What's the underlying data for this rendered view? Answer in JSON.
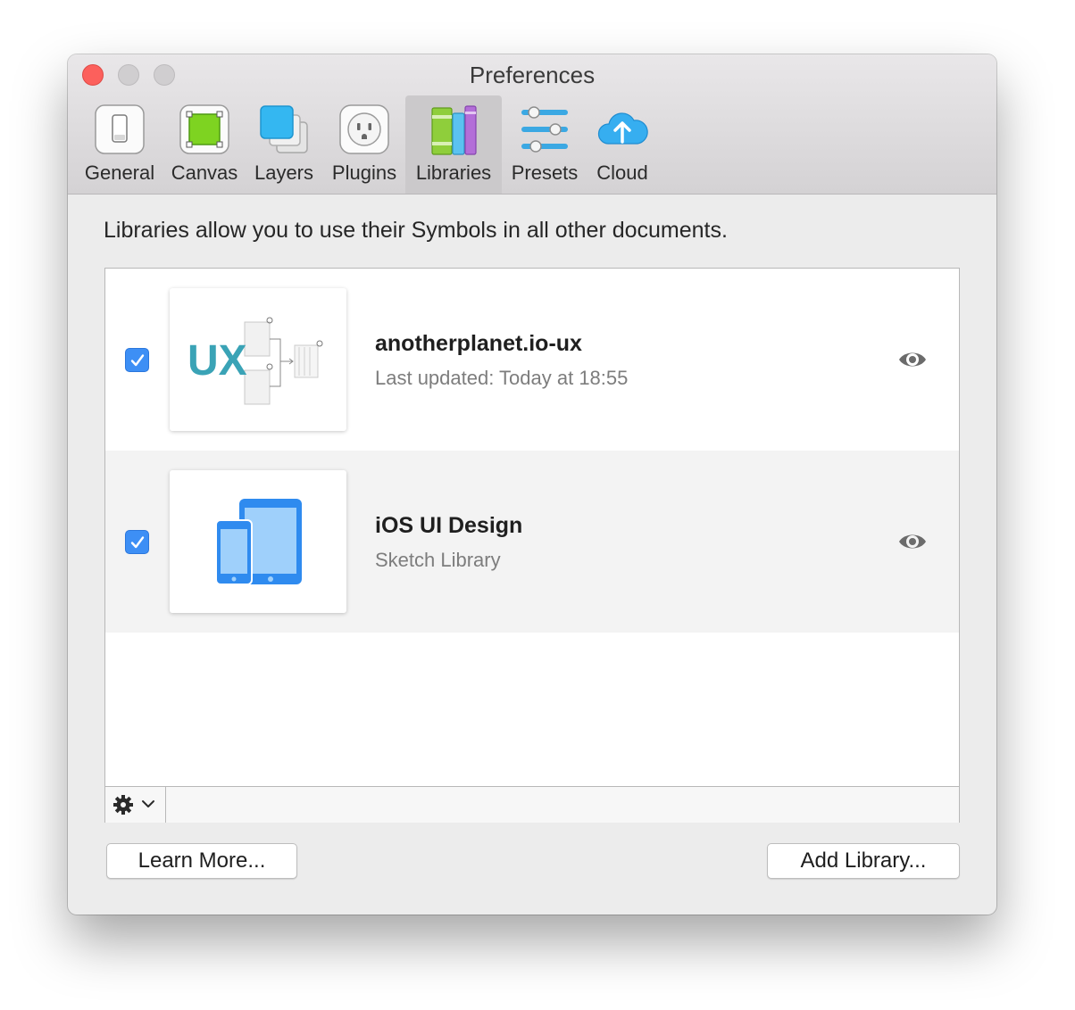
{
  "window": {
    "title": "Preferences"
  },
  "toolbar": {
    "tabs": [
      {
        "label": "General",
        "icon": "general-icon"
      },
      {
        "label": "Canvas",
        "icon": "canvas-icon"
      },
      {
        "label": "Layers",
        "icon": "layers-icon"
      },
      {
        "label": "Plugins",
        "icon": "plugins-icon"
      },
      {
        "label": "Libraries",
        "icon": "libraries-icon",
        "active": true
      },
      {
        "label": "Presets",
        "icon": "presets-icon"
      },
      {
        "label": "Cloud",
        "icon": "cloud-icon"
      }
    ]
  },
  "main": {
    "description": "Libraries allow you to use their Symbols in all other documents.",
    "libraries": [
      {
        "name": "anotherplanet.io-ux",
        "subtitle": "Last updated: Today at 18:55",
        "enabled": true,
        "thumbnail_text": "UX"
      },
      {
        "name": "iOS UI Design",
        "subtitle": "Sketch Library",
        "enabled": true
      }
    ],
    "list_footer": {
      "menu_icon": "gear-icon",
      "chevron_icon": "chevron-down-icon"
    }
  },
  "buttons": {
    "learn_more": "Learn More...",
    "add_library": "Add Library..."
  },
  "colors": {
    "accent": "#3d8ff5",
    "close": "#fc605c",
    "ux_teal": "#3aa3b6"
  }
}
